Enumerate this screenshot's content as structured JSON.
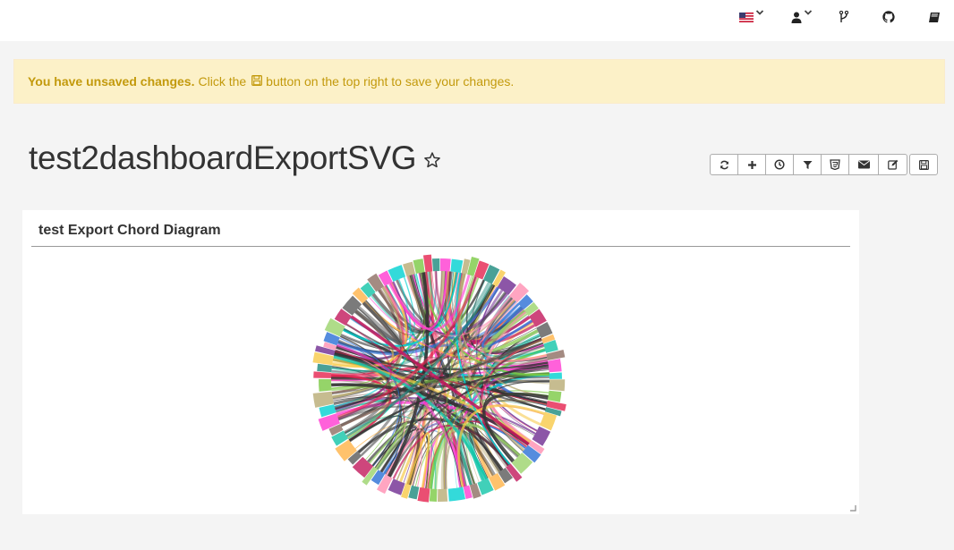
{
  "navbar": {
    "icons": [
      "us-flag-icon",
      "user-icon",
      "code-fork-icon",
      "github-icon",
      "book-icon"
    ]
  },
  "alert": {
    "bold_text": "You have unsaved changes.",
    "text_before_icon": "Click the",
    "text_after_icon": "button on the top right to save your changes.",
    "color": "#c39a0d",
    "background": "#fcf1c8"
  },
  "dashboard": {
    "title": "test2dashboardExportSVG"
  },
  "toolbar": {
    "buttons": [
      "refresh-icon",
      "plus-icon",
      "clock-icon",
      "filter-icon",
      "css3-icon",
      "envelope-icon",
      "edit-icon",
      "save-icon"
    ]
  },
  "panel": {
    "title": "test Export Chord Diagram"
  },
  "chart_data": {
    "type": "chord",
    "palette": [
      "#ff3ad1",
      "#00d1d1",
      "#b8ab74",
      "#7ac943",
      "#e5234f",
      "#1c8a7d",
      "#f7c948",
      "#6f2c91",
      "#ff8fb1",
      "#2a6fd6",
      "#9bd36b",
      "#c2185b",
      "#5a5a5a",
      "#ffb347",
      "#11c4a8",
      "#8d6e63"
    ]
  }
}
